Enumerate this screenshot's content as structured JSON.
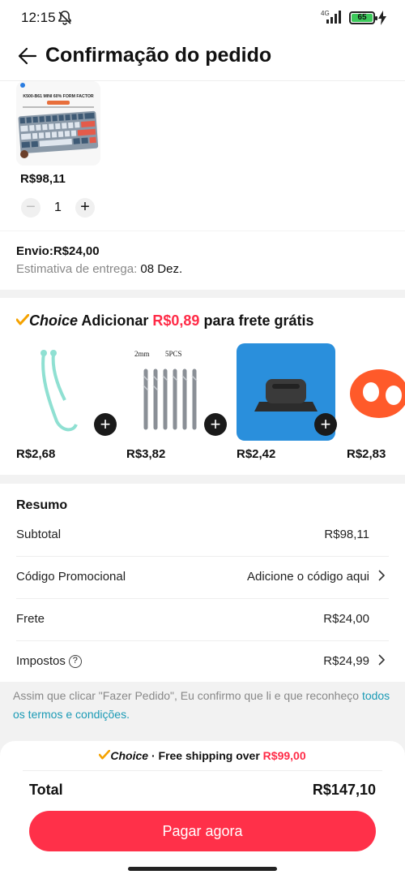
{
  "status": {
    "time": "12:15",
    "network": "4G",
    "battery": "65"
  },
  "header": {
    "title": "Confirmação do pedido"
  },
  "product": {
    "image_text": "K500-B61 MINI 60% FORM FACTOR",
    "price": "R$98,11",
    "quantity": "1",
    "minus": "−",
    "plus": "+"
  },
  "shipping": {
    "price": "Envio:R$24,00",
    "estimate_label": "Estimativa de entrega:",
    "estimate_value": "08 Dez."
  },
  "choice": {
    "logo": "Choice",
    "prefix": "Adicionar",
    "amount": "R$0,89",
    "suffix": "para frete grátis",
    "items": [
      {
        "price": "R$2,68"
      },
      {
        "price": "R$3,82",
        "label_a": "2mm",
        "label_b": "5PCS"
      },
      {
        "price": "R$2,42"
      },
      {
        "price": "R$2,83"
      }
    ]
  },
  "summary": {
    "title": "Resumo",
    "subtotal_label": "Subtotal",
    "subtotal_value": "R$98,11",
    "promo_label": "Código Promocional",
    "promo_value": "Adicione o código aqui",
    "shipping_label": "Frete",
    "shipping_value": "R$24,00",
    "tax_label": "Impostos",
    "tax_value": "R$24,99"
  },
  "terms": {
    "text": "Assim que clicar \"Fazer Pedido\", Eu confirmo que li e que reconheço",
    "link": "todos os termos e condições."
  },
  "checkout": {
    "choice_logo": "Choice",
    "banner_text": "· Free shipping over",
    "banner_amount": "R$99,00",
    "total_label": "Total",
    "total_value": "R$147,10",
    "pay_label": "Pagar agora"
  },
  "colors": {
    "accent": "#ff3049",
    "choice_check": "#f5a200",
    "link": "#1a9ab5"
  }
}
